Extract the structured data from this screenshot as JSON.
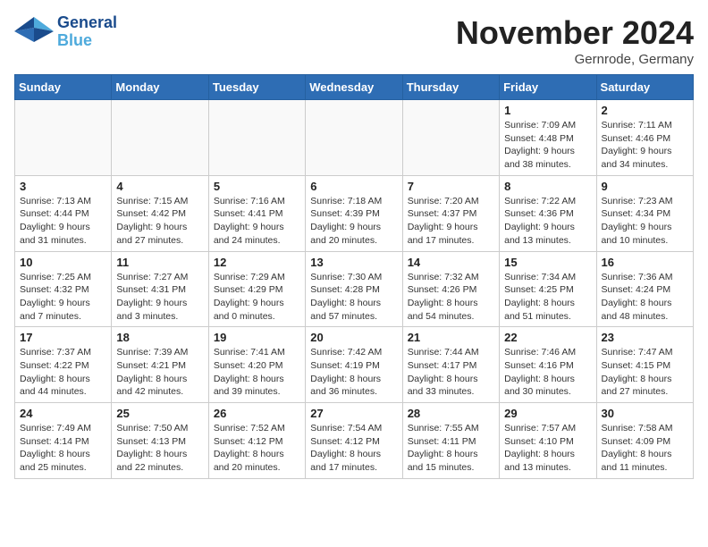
{
  "header": {
    "month_year": "November 2024",
    "location": "Gernrode, Germany",
    "logo_general": "General",
    "logo_blue": "Blue"
  },
  "weekdays": [
    "Sunday",
    "Monday",
    "Tuesday",
    "Wednesday",
    "Thursday",
    "Friday",
    "Saturday"
  ],
  "weeks": [
    [
      {
        "day": "",
        "info": ""
      },
      {
        "day": "",
        "info": ""
      },
      {
        "day": "",
        "info": ""
      },
      {
        "day": "",
        "info": ""
      },
      {
        "day": "",
        "info": ""
      },
      {
        "day": "1",
        "info": "Sunrise: 7:09 AM\nSunset: 4:48 PM\nDaylight: 9 hours\nand 38 minutes."
      },
      {
        "day": "2",
        "info": "Sunrise: 7:11 AM\nSunset: 4:46 PM\nDaylight: 9 hours\nand 34 minutes."
      }
    ],
    [
      {
        "day": "3",
        "info": "Sunrise: 7:13 AM\nSunset: 4:44 PM\nDaylight: 9 hours\nand 31 minutes."
      },
      {
        "day": "4",
        "info": "Sunrise: 7:15 AM\nSunset: 4:42 PM\nDaylight: 9 hours\nand 27 minutes."
      },
      {
        "day": "5",
        "info": "Sunrise: 7:16 AM\nSunset: 4:41 PM\nDaylight: 9 hours\nand 24 minutes."
      },
      {
        "day": "6",
        "info": "Sunrise: 7:18 AM\nSunset: 4:39 PM\nDaylight: 9 hours\nand 20 minutes."
      },
      {
        "day": "7",
        "info": "Sunrise: 7:20 AM\nSunset: 4:37 PM\nDaylight: 9 hours\nand 17 minutes."
      },
      {
        "day": "8",
        "info": "Sunrise: 7:22 AM\nSunset: 4:36 PM\nDaylight: 9 hours\nand 13 minutes."
      },
      {
        "day": "9",
        "info": "Sunrise: 7:23 AM\nSunset: 4:34 PM\nDaylight: 9 hours\nand 10 minutes."
      }
    ],
    [
      {
        "day": "10",
        "info": "Sunrise: 7:25 AM\nSunset: 4:32 PM\nDaylight: 9 hours\nand 7 minutes."
      },
      {
        "day": "11",
        "info": "Sunrise: 7:27 AM\nSunset: 4:31 PM\nDaylight: 9 hours\nand 3 minutes."
      },
      {
        "day": "12",
        "info": "Sunrise: 7:29 AM\nSunset: 4:29 PM\nDaylight: 9 hours\nand 0 minutes."
      },
      {
        "day": "13",
        "info": "Sunrise: 7:30 AM\nSunset: 4:28 PM\nDaylight: 8 hours\nand 57 minutes."
      },
      {
        "day": "14",
        "info": "Sunrise: 7:32 AM\nSunset: 4:26 PM\nDaylight: 8 hours\nand 54 minutes."
      },
      {
        "day": "15",
        "info": "Sunrise: 7:34 AM\nSunset: 4:25 PM\nDaylight: 8 hours\nand 51 minutes."
      },
      {
        "day": "16",
        "info": "Sunrise: 7:36 AM\nSunset: 4:24 PM\nDaylight: 8 hours\nand 48 minutes."
      }
    ],
    [
      {
        "day": "17",
        "info": "Sunrise: 7:37 AM\nSunset: 4:22 PM\nDaylight: 8 hours\nand 44 minutes."
      },
      {
        "day": "18",
        "info": "Sunrise: 7:39 AM\nSunset: 4:21 PM\nDaylight: 8 hours\nand 42 minutes."
      },
      {
        "day": "19",
        "info": "Sunrise: 7:41 AM\nSunset: 4:20 PM\nDaylight: 8 hours\nand 39 minutes."
      },
      {
        "day": "20",
        "info": "Sunrise: 7:42 AM\nSunset: 4:19 PM\nDaylight: 8 hours\nand 36 minutes."
      },
      {
        "day": "21",
        "info": "Sunrise: 7:44 AM\nSunset: 4:17 PM\nDaylight: 8 hours\nand 33 minutes."
      },
      {
        "day": "22",
        "info": "Sunrise: 7:46 AM\nSunset: 4:16 PM\nDaylight: 8 hours\nand 30 minutes."
      },
      {
        "day": "23",
        "info": "Sunrise: 7:47 AM\nSunset: 4:15 PM\nDaylight: 8 hours\nand 27 minutes."
      }
    ],
    [
      {
        "day": "24",
        "info": "Sunrise: 7:49 AM\nSunset: 4:14 PM\nDaylight: 8 hours\nand 25 minutes."
      },
      {
        "day": "25",
        "info": "Sunrise: 7:50 AM\nSunset: 4:13 PM\nDaylight: 8 hours\nand 22 minutes."
      },
      {
        "day": "26",
        "info": "Sunrise: 7:52 AM\nSunset: 4:12 PM\nDaylight: 8 hours\nand 20 minutes."
      },
      {
        "day": "27",
        "info": "Sunrise: 7:54 AM\nSunset: 4:12 PM\nDaylight: 8 hours\nand 17 minutes."
      },
      {
        "day": "28",
        "info": "Sunrise: 7:55 AM\nSunset: 4:11 PM\nDaylight: 8 hours\nand 15 minutes."
      },
      {
        "day": "29",
        "info": "Sunrise: 7:57 AM\nSunset: 4:10 PM\nDaylight: 8 hours\nand 13 minutes."
      },
      {
        "day": "30",
        "info": "Sunrise: 7:58 AM\nSunset: 4:09 PM\nDaylight: 8 hours\nand 11 minutes."
      }
    ]
  ]
}
